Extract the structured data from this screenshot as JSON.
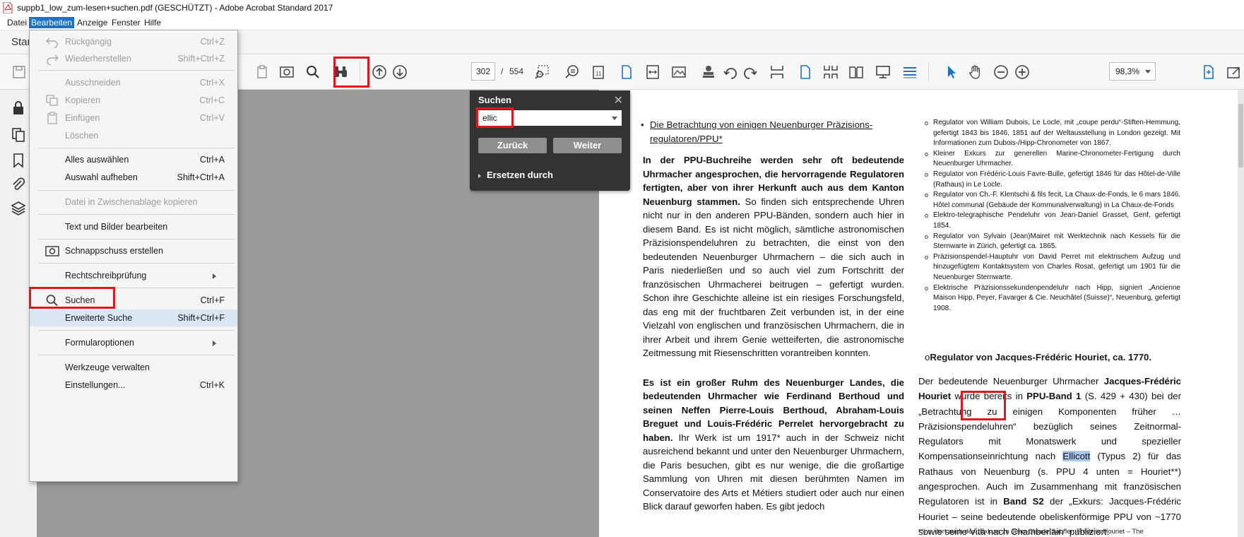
{
  "window": {
    "title": "suppb1_low_zum-lesen+suchen.pdf (GESCHÜTZT) - Adobe Acrobat Standard 2017"
  },
  "menubar": [
    "Datei",
    "Bearbeiten",
    "Anzeige",
    "Fenster",
    "Hilfe"
  ],
  "tab": {
    "label": "Star"
  },
  "toolbar": {
    "page_current": "302",
    "page_separator": "/",
    "page_total": "554",
    "zoom": "98,3%"
  },
  "edit_menu": {
    "undo": {
      "label": "Rückgängig",
      "shortcut": "Ctrl+Z"
    },
    "redo": {
      "label": "Wiederherstellen",
      "shortcut": "Shift+Ctrl+Z"
    },
    "cut": {
      "label": "Ausschneiden",
      "shortcut": "Ctrl+X"
    },
    "copy": {
      "label": "Kopieren",
      "shortcut": "Ctrl+C"
    },
    "paste": {
      "label": "Einfügen",
      "shortcut": "Ctrl+V"
    },
    "delete": {
      "label": "Löschen"
    },
    "select_all": {
      "label": "Alles auswählen",
      "shortcut": "Ctrl+A"
    },
    "deselect": {
      "label": "Auswahl aufheben",
      "shortcut": "Shift+Ctrl+A"
    },
    "copy_file": {
      "label": "Datei in Zwischenablage kopieren"
    },
    "edit_text": {
      "label": "Text und Bilder bearbeiten"
    },
    "snapshot": {
      "label": "Schnappschuss erstellen"
    },
    "spellcheck": {
      "label": "Rechtschreibprüfung"
    },
    "search": {
      "label": "Suchen",
      "shortcut": "Ctrl+F"
    },
    "advanced_search": {
      "label": "Erweiterte Suche",
      "shortcut": "Shift+Ctrl+F"
    },
    "form_options": {
      "label": "Formularoptionen"
    },
    "manage_tools": {
      "label": "Werkzeuge verwalten"
    },
    "preferences": {
      "label": "Einstellungen...",
      "shortcut": "Ctrl+K"
    }
  },
  "search_panel": {
    "title": "Suchen",
    "query": "ellic",
    "back": "Zurück",
    "next": "Weiter",
    "replace": "Ersetzen durch"
  },
  "document": {
    "left_heading": "Die Betrachtung von einigen Neuenburger Präzisions-regulatoren/PPU*",
    "left_p1_bold": "In der PPU-Buchreihe werden sehr oft bedeutende Uhrmacher angesprochen, die hervorragende Regulatoren fertigten, aber von ihrer Herkunft auch aus dem Kanton Neuenburg stammen.",
    "left_p1_rest": " So finden sich entsprechende Uhren nicht nur in den anderen PPU-Bänden, sondern auch hier in diesem Band. Es ist nicht möglich, sämtliche astronomischen Präzisionspendeluhren zu betrachten, die einst von den bedeutenden Neuenburger Uhrmachern – die sich auch in Paris niederließen und so auch viel zum Fortschritt der französischen Uhrmacherei beitrugen – gefertigt wurden. Schon ihre Geschichte alleine ist ein riesiges Forschungsfeld, das eng mit der fruchtbaren Zeit verbunden ist, in der eine Vielzahl von englischen und französischen Uhrmachern, die in ihrer Arbeit und ihrem Genie wetteiferten, die astronomische Zeitmessung mit Riesenschritten vorantreiben konnten.",
    "left_p2_bold": "Es ist ein großer Ruhm des Neuenburger Landes, die bedeutenden Uhrmacher wie Ferdinand Berthoud und seinen Neffen Pierre-Louis Berthoud, Abraham-Louis Breguet und Louis-Frédéric Perrelet hervorgebracht zu haben.",
    "left_p2_rest": " Ihr Werk ist um 1917* auch in der Schweiz nicht ausreichend bekannt und unter den Neuenburger Uhrmachern, die Paris besuchen, gibt es nur wenige, die die großartige Sammlung von Uhren mit diesen berühmten Namen im Conservatoire des Arts et Métiers studiert oder auch nur einen Blick darauf geworfen haben. Es gibt jedoch",
    "right_items": [
      "Regulator von William Dubois, Le Locle, mit „coupe perdu“-Stiften-Hemmung, gefertigt 1843 bis 1846, 1851 auf der Weltausstellung in London gezeigt. Mit Informationen zum Dubois-/Hipp-Chronometer von 1867.",
      "Kleiner Exkurs zur generellen Marine-Chronometer-Fertigung durch Neuenburger Uhrmacher.",
      "Regulator von Frédéric-Louis Favre-Bulle, gefertigt 1846 für das Hôtel-de-Ville (Rathaus) in Le Locle.",
      "Regulator von Ch.-F. Klentschi & fils fecit, La Chaux-de-Fonds, le 6 mars 1846. Hôtel communal (Gebäude der Kommunalverwaltung) in La Chaux-de-Fonds",
      "Elektro-telegraphische Pendeluhr von Jean-Daniel Grasset, Genf, gefertigt 1854.",
      "Regulator von Sylvain (Jean)Mairet mit Werktechnik nach Kessels für die Sternwarte in Zürich, gefertigt ca. 1865.",
      "Präzisionspendel-Hauptuhr von David Perret mit elektrischem Aufzug und hinzugefügtem Kontaktsystem von Charles Rosat, gefertigt um 1901 für die Neuenburger Sternwarte.",
      "Elektrische Präzisionssekundenpendeluhr nach Hipp, signiert „Ancienne Maison Hipp, Peyer, Favarger & Cie. Neuchâtel (Suisse)“, Neuenburg, gefertigt 1908."
    ],
    "right_heading": "Regulator von Jacques-Frédéric Houriet, ca. 1770.",
    "right_body_1": "Der bedeutende Neuenburger Uhrmacher ",
    "right_body_name": "Jacques-Frédéric Houriet",
    "right_body_2": " wurde bereits in ",
    "right_body_band": "PPU-Band 1",
    "right_body_3": " (S. 429 + 430) bei der „Betrachtung zu einigen Komponenten früher … Präzisionspendeluhren“ bezüglich seines Zeitnormal-Regulators mit Monatswerk und spezieller Kompensationseinrichtung nach ",
    "right_body_match": "Ellicott",
    "right_body_4": " (Typus 2) für das Rathaus von Neuenburg (s. PPU 4 unten = Houriet**) angesprochen. Auch im Zusammenhang mit französischen Regulatoren ist in ",
    "right_body_band2": "Band S2",
    "right_body_5": " der „Exkurs: Jacques-Frédéric Houriet – seine bedeutende obeliskenförmige PPU von ~1770 sowie seine Vita nach Chamberlain“ publiziert.",
    "right_footnote": "**) s. dort auch den „Exkurs zu Jean-Claude Sabrier: Frédéric Houriet – The"
  },
  "colors": {
    "highlight_box": "#e4161b",
    "menu_active": "#1a73c8",
    "search_match": "#a9c9ee",
    "acrobat_blue": "#1a73c8"
  }
}
